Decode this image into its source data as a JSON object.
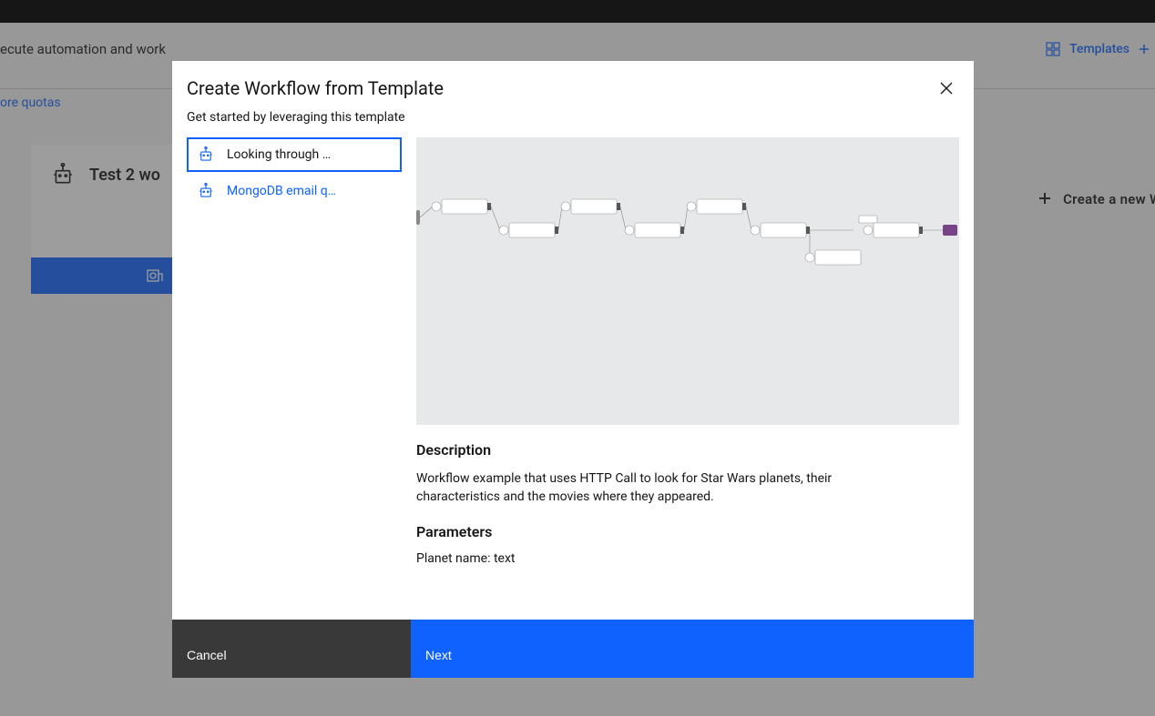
{
  "background": {
    "header_fragment": "ecute automation and work",
    "link_quotas": "ore quotas",
    "templates_label": "Templates",
    "card_title": "Test 2 wo",
    "create_new_label": "Create a new Work"
  },
  "modal": {
    "title": "Create Workflow from Template",
    "subtitle": "Get started by leveraging this template",
    "templates": [
      {
        "label": "Looking through …",
        "selected": true
      },
      {
        "label": "MongoDB email q…",
        "selected": false
      }
    ],
    "description_title": "Description",
    "description_text": "Workflow example that uses HTTP Call to look for Star Wars planets, their characteristics and the movies where they appeared.",
    "parameters_title": "Parameters",
    "parameters_text": "Planet name: text",
    "cancel_label": "Cancel",
    "next_label": "Next"
  },
  "icons": {
    "robot": "robot-icon",
    "close": "close-icon",
    "templates": "templates-icon",
    "plus": "plus-icon"
  },
  "colors": {
    "primary": "#0f62fe",
    "dark": "#161616",
    "footer_dark": "#393939",
    "preview_bg": "#e6e8ea"
  }
}
